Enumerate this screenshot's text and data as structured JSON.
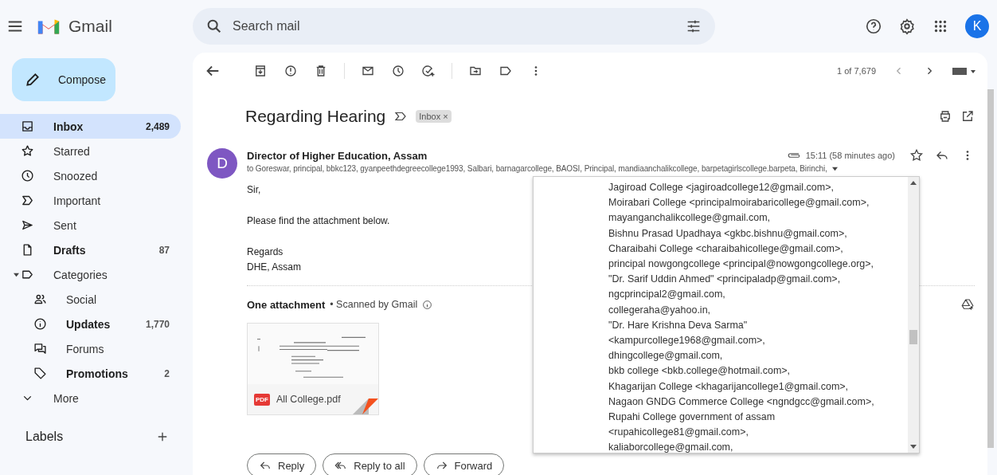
{
  "app": {
    "name": "Gmail",
    "account_initial": "K"
  },
  "search": {
    "placeholder": "Search mail"
  },
  "compose": {
    "label": "Compose"
  },
  "sidebar": {
    "items": [
      {
        "label": "Inbox",
        "count": "2,489",
        "selected": true,
        "unread": true
      },
      {
        "label": "Starred",
        "selected": false,
        "unread": false
      },
      {
        "label": "Snoozed",
        "selected": false,
        "unread": false
      },
      {
        "label": "Important",
        "selected": false,
        "unread": false
      },
      {
        "label": "Sent",
        "selected": false,
        "unread": false
      },
      {
        "label": "Drafts",
        "count": "87",
        "selected": false,
        "unread": true
      },
      {
        "label": "Categories",
        "selected": false,
        "unread": false,
        "expanded": true,
        "children": [
          {
            "label": "Social",
            "selected": false,
            "unread": false
          },
          {
            "label": "Updates",
            "count": "1,770",
            "selected": false,
            "unread": true
          },
          {
            "label": "Forums",
            "selected": false,
            "unread": false
          },
          {
            "label": "Promotions",
            "count": "2",
            "selected": false,
            "unread": true
          }
        ]
      },
      {
        "label": "More",
        "selected": false,
        "unread": false
      }
    ],
    "labels_heading": "Labels"
  },
  "toolbar": {
    "pagination": "1 of 7,679"
  },
  "message": {
    "subject": "Regarding Hearing",
    "label_chip": "Inbox",
    "label_chip_close": "×",
    "sender_initial": "D",
    "sender": "Director of Higher Education, Assam",
    "to_line": "to Goreswar, principal, bbkc123, gyanpeethdegreecollege1993, Salbari, barnagarcollege, BAOSI, Principal, mandiaanchalikcollege, barpetagirlscollege.barpeta, Birinchi,",
    "time": "15:11 (58 minutes ago)",
    "starred": false,
    "body": [
      [
        "Sir,"
      ],
      [
        "Please find the attachment below."
      ],
      [
        "Regards",
        "DHE, Assam"
      ]
    ],
    "attachments_heading": "One attachment",
    "scan_note": "• Scanned by Gmail",
    "attachment": {
      "badge": "PDF",
      "filename": "All College.pdf"
    },
    "actions": [
      "Reply",
      "Reply to all",
      "Forward"
    ]
  },
  "recipients_popup": {
    "lines": [
      "Jagiroad College <jagiroadcollege12@gmail.com>,",
      "Moirabari College <principalmoirabaricollege@gmail.com>,",
      "mayanganchalikcollege@gmail.com,",
      "Bishnu Prasad Upadhaya <gkbc.bishnu@gmail.com>,",
      "Charaibahi College <charaibahicollege@gmail.com>,",
      "principal nowgongcollege <principal@nowgongcollege.org>,",
      "\"Dr. Sarif Uddin Ahmed\" <principaladp@gmail.com>,",
      "ngcprincipal2@gmail.com,",
      "collegeraha@yahoo.in,",
      "\"Dr. Hare Krishna Deva Sarma\"",
      "<kampurcollege1968@gmail.com>,",
      "dhingcollege@gmail.com,",
      "bkb college <bkb.college@hotmail.com>,",
      "Khagarijan College <khagarijancollege1@gmail.com>,",
      "Nagaon GNDG Commerce College <ngndgcc@gmail.com>,",
      "Rupahi College government of assam",
      "<rupahicollege81@gmail.com>,",
      "kaliaborcollege@gmail.com,"
    ]
  }
}
